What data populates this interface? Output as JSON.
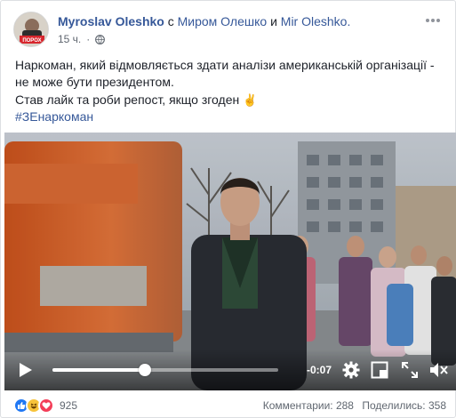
{
  "post": {
    "author": "Myroslav Oleshko",
    "with_word": "с",
    "friend_1": "Миром Олешко",
    "and_word": "и",
    "friend_2": "Mir Oleshko.",
    "time": "15 ч.",
    "dot": "·",
    "privacy_icon": "globe-icon",
    "more_icon": "ellipsis-icon",
    "avatar_badge": "ПОРОХ"
  },
  "text": {
    "line_1": "Наркоман, який відмовляється здати аналізи американській організації -",
    "line_2": "не може бути президентом.",
    "line_3": "Став лайк та роби репост, якщо згоден",
    "emoji": "✌",
    "hashtag": "#ЗЕнаркоман"
  },
  "video": {
    "progress": 0.41,
    "time_remaining": "-0:07",
    "controls": [
      "play-icon",
      "gear-icon",
      "fullscreen-exit-icon",
      "expand-icon",
      "volume-muted-icon"
    ]
  },
  "footer": {
    "reactions": [
      "like",
      "haha",
      "love"
    ],
    "reaction_count": "925",
    "comments": "Комментарии: 288",
    "shares": "Поделились: 358"
  },
  "colors": {
    "link": "#365899",
    "meta": "#606770",
    "like": "#2078f4",
    "haha": "#f7c33b",
    "love": "#f33e58"
  }
}
